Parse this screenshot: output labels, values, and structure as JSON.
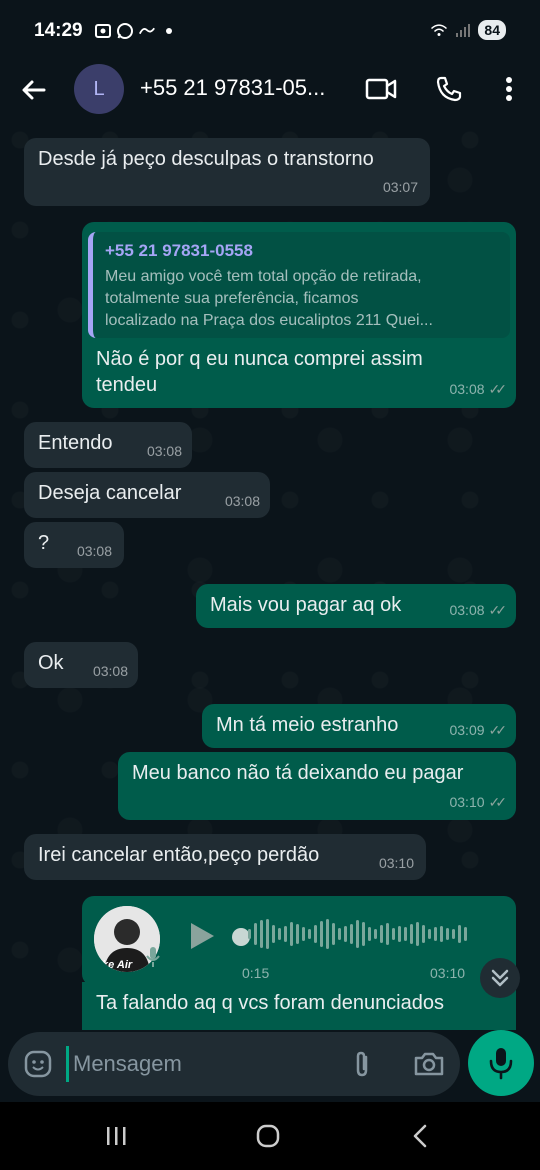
{
  "status": {
    "time": "14:29",
    "battery": "84"
  },
  "header": {
    "avatar_letter": "L",
    "contact_name": "+55 21 97831-05..."
  },
  "messages": [
    {
      "text": "Desde já peço desculpas o transtorno",
      "time": "03:07"
    },
    {
      "quote_name": "+55 21 97831-0558",
      "quote_line1": "Meu amigo você tem total opção de retirada,",
      "quote_line2": "totalmente sua preferência, ficamos",
      "quote_line3": "localizado na Praça dos eucaliptos 211 Quei...",
      "line1": "Não é por q eu nunca comprei assim",
      "line2": "tendeu",
      "time": "03:08"
    },
    {
      "text": "Entendo",
      "time": "03:08"
    },
    {
      "text": "Deseja cancelar",
      "time": "03:08"
    },
    {
      "text": "?",
      "time": "03:08"
    },
    {
      "text": "Mais vou pagar aq ok",
      "time": "03:08"
    },
    {
      "text": "Ok",
      "time": "03:08"
    },
    {
      "text": "Mn tá meio estranho",
      "time": "03:09"
    },
    {
      "text": "Meu banco não tá deixando eu pagar",
      "time": "03:10"
    },
    {
      "text": "Irei cancelar então,peço perdão",
      "time": "03:10"
    },
    {
      "avatar_caption": "ke Air",
      "duration": "0:15",
      "time": "03:10"
    },
    {
      "text": "Ta falando aq q vcs foram denunciados"
    }
  ],
  "input": {
    "placeholder": "Mensagem"
  },
  "colors": {
    "incoming": "#202c33",
    "outgoing": "#005c4b",
    "accent": "#00a884",
    "background": "#0b141a"
  }
}
